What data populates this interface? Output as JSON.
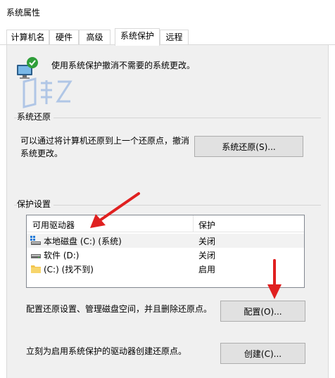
{
  "window": {
    "title": "系统属性"
  },
  "tabs": [
    {
      "label": "计算机名",
      "active": false
    },
    {
      "label": "硬件",
      "active": false
    },
    {
      "label": "高级",
      "active": false
    },
    {
      "label": "系统保护",
      "active": true
    },
    {
      "label": "远程",
      "active": false
    }
  ],
  "intro": {
    "text": "使用系统保护撤消不需要的系统更改。"
  },
  "restore": {
    "section_title": "系统还原",
    "description_line1": "可以通过将计算机还原到上一个还原点，撤消",
    "description_line2": "系统更改。",
    "button_label": "系统还原(S)..."
  },
  "protection": {
    "section_title": "保护设置",
    "columns": [
      "可用驱动器",
      "保护"
    ],
    "drives": [
      {
        "name": "本地磁盘 (C:) (系统)",
        "status": "关闭",
        "icon": "system-drive-icon",
        "selected": true
      },
      {
        "name": "软件 (D:)",
        "status": "关闭",
        "icon": "hard-drive-icon",
        "selected": false
      },
      {
        "name": "(C:) (找不到)",
        "status": "启用",
        "icon": "folder-icon",
        "selected": false
      }
    ],
    "configure_text": "配置还原设置、管理磁盘空间，并且删除还原点。",
    "configure_button": "配置(O)...",
    "create_text": "立刻为启用系统保护的驱动器创建还原点。",
    "create_button": "创建(C)..."
  },
  "colors": {
    "annotation_arrow": "#e02020",
    "panel": "#f0f0f0",
    "selection": "#f2f2f2"
  }
}
